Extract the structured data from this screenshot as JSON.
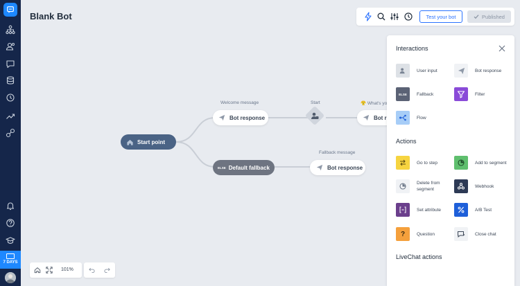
{
  "app": {
    "title": "Blank Bot"
  },
  "sidebar": {
    "items": [
      "logo-icon",
      "structure-icon",
      "users-icon",
      "chat-icon",
      "database-icon",
      "history-icon",
      "analytics-icon",
      "integrations-icon"
    ],
    "bottom_items": [
      "bell-icon",
      "help-icon",
      "academy-icon"
    ],
    "trial_label": "7 DAYS"
  },
  "toolbar": {
    "test_label": "Test your bot",
    "published_label": "Published"
  },
  "canvas": {
    "start_node": "Start point",
    "welcome_label": "Welcome message",
    "bot_response_1": "Bot response",
    "start_label": "Start",
    "whats_label": "😤 What's yo",
    "bot_response_partial": "Bot re",
    "default_fallback_tag": "ELSE",
    "default_fallback": "Default fallback",
    "fallback_label": "Fallback message",
    "bot_response_2": "Bot response"
  },
  "panel": {
    "interactions_title": "Interactions",
    "interactions": [
      {
        "label": "User input",
        "icon": "user-input-icon",
        "color": "#dde1e6"
      },
      {
        "label": "Bot response",
        "icon": "paper-plane-icon",
        "color": "#f0f2f5"
      },
      {
        "label": "Fallback",
        "icon": "else-icon",
        "color": "#5b6275",
        "tag": "ELSE"
      },
      {
        "label": "Filter",
        "icon": "filter-icon",
        "color": "#8a4bd8"
      },
      {
        "label": "Flow",
        "icon": "flow-icon",
        "color": "#a7cdf7"
      }
    ],
    "actions_title": "Actions",
    "actions": [
      {
        "label": "Go to step",
        "icon": "goto-icon",
        "color": "#f6d440"
      },
      {
        "label": "Add to segment",
        "icon": "segment-add-icon",
        "color": "#5fbf6e"
      },
      {
        "label": "Delete from segment",
        "icon": "segment-delete-icon",
        "color": "#f0f2f5"
      },
      {
        "label": "Webhook",
        "icon": "webhook-icon",
        "color": "#2d3a55"
      },
      {
        "label": "Set attribute",
        "icon": "attribute-icon",
        "color": "#6b3f8c"
      },
      {
        "label": "A/B Test",
        "icon": "ab-test-icon",
        "color": "#1e5fd9"
      },
      {
        "label": "Question",
        "icon": "question-icon",
        "color": "#f5a03c",
        "tag": "?"
      },
      {
        "label": "Close chat",
        "icon": "close-chat-icon",
        "color": "#f0f2f5"
      }
    ],
    "livechat_title": "LiveChat actions"
  },
  "bottom": {
    "zoom": "101%"
  }
}
